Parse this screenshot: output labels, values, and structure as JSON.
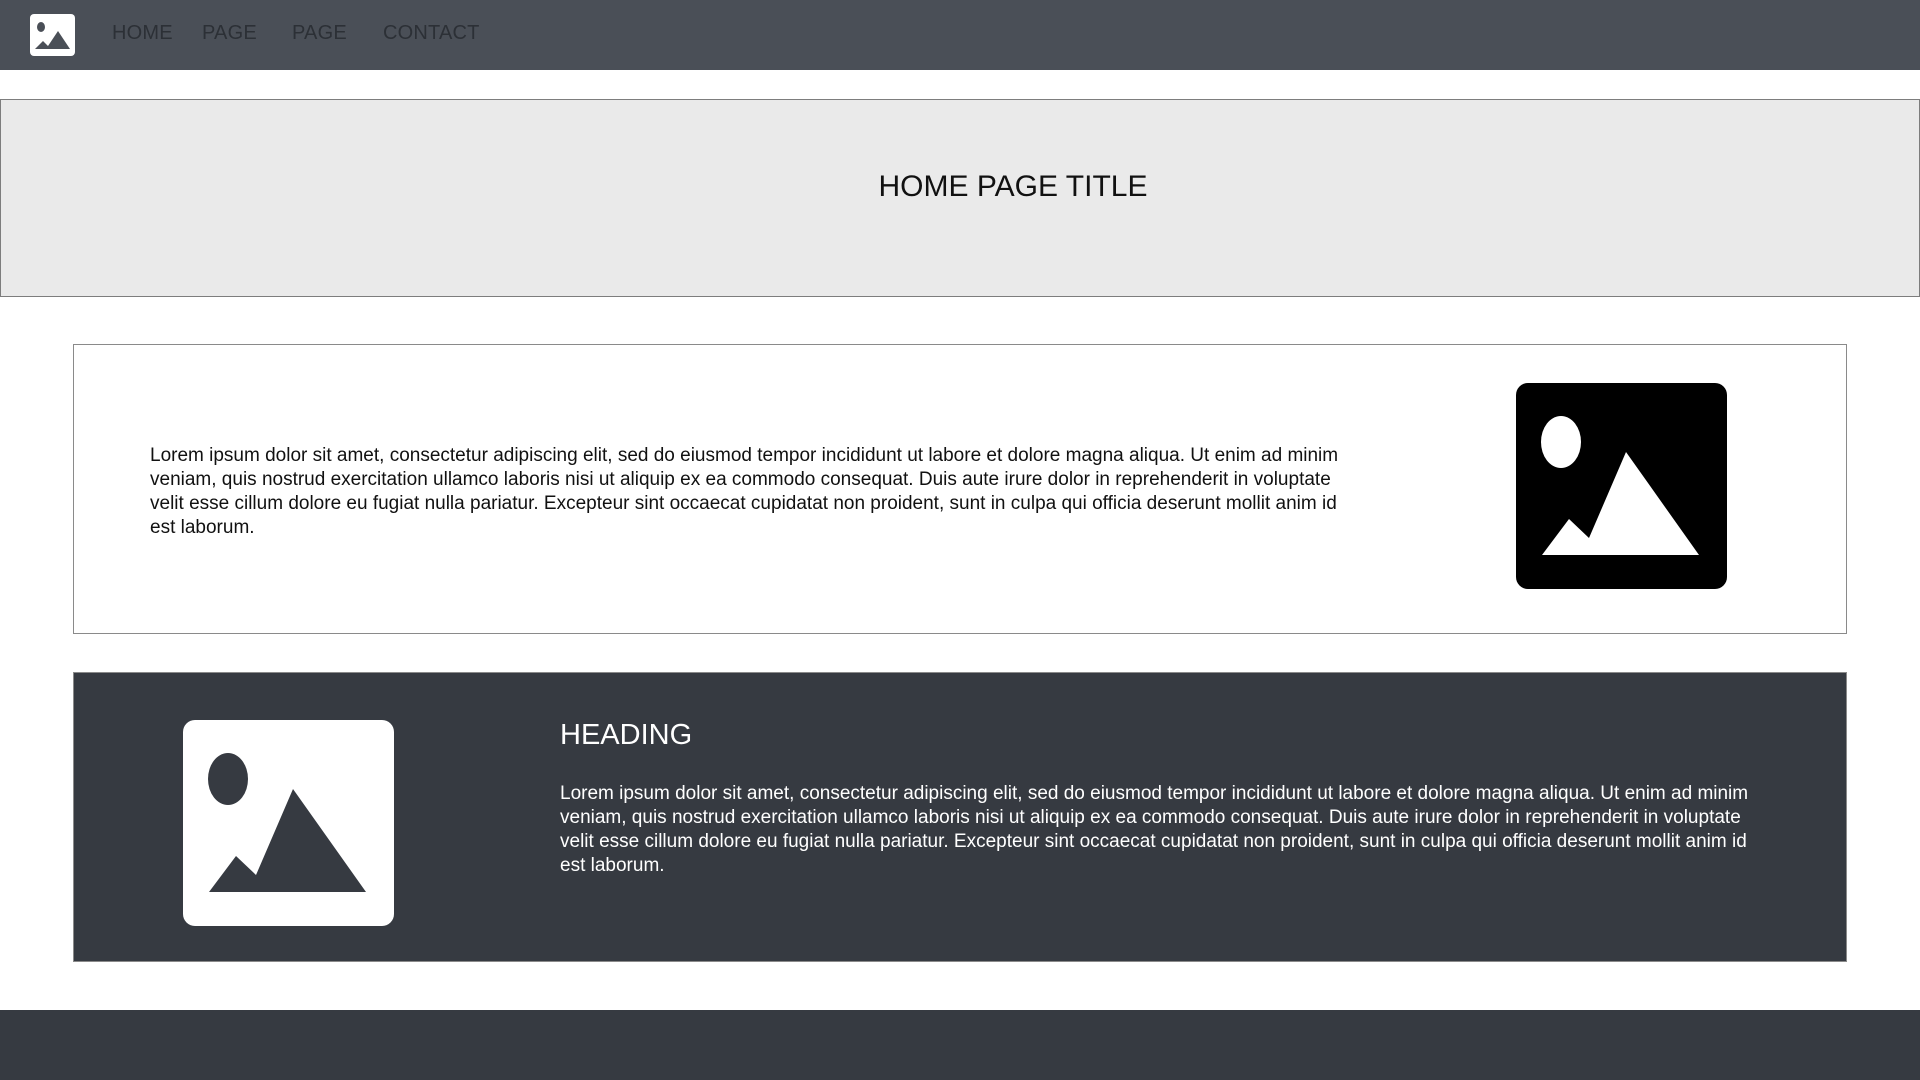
{
  "nav": {
    "links": [
      {
        "label": "HOME"
      },
      {
        "label": "PAGE"
      },
      {
        "label": "PAGE"
      },
      {
        "label": "CONTACT"
      }
    ]
  },
  "hero": {
    "title": "HOME PAGE TITLE"
  },
  "section_1": {
    "body": "Lorem ipsum dolor sit amet, consectetur adipiscing elit, sed do eiusmod tempor incididunt ut labore et dolore magna aliqua. Ut enim ad minim veniam, quis nostrud exercitation ullamco laboris nisi ut aliquip ex ea commodo consequat. Duis aute irure dolor in reprehenderit in voluptate velit esse cillum dolore eu fugiat nulla pariatur. Excepteur sint occaecat cupidatat non proident, sunt in culpa qui officia deserunt mollit anim id est laborum.",
    "image_icon": "image-placeholder-icon"
  },
  "section_2": {
    "heading": "HEADING",
    "body": "Lorem ipsum dolor sit amet, consectetur adipiscing elit, sed do eiusmod tempor incididunt ut labore et dolore magna aliqua. Ut enim ad minim veniam, quis nostrud exercitation ullamco laboris nisi ut aliquip ex ea commodo consequat. Duis aute irure dolor in reprehenderit in voluptate velit esse cillum dolore eu fugiat nulla pariatur. Excepteur sint occaecat cupidatat non proident, sunt in culpa qui officia deserunt mollit anim id est laborum.",
    "image_icon": "image-placeholder-icon"
  },
  "colors": {
    "navbar_bg": "#4a4f57",
    "nav_link": "#2c3036",
    "hero_bg": "#eaeaea",
    "dark_section_bg": "#363a41",
    "footer_bg": "#363a41"
  }
}
